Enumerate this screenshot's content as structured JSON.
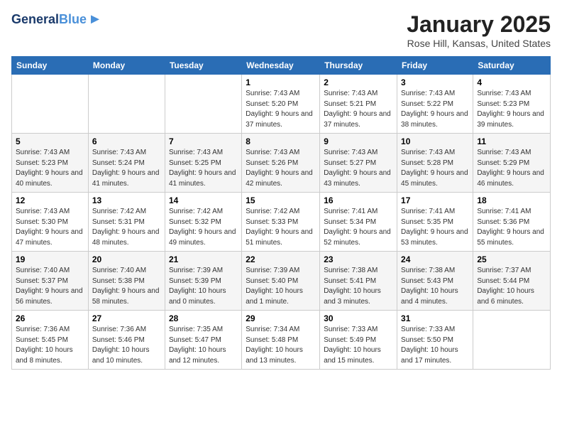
{
  "logo": {
    "line1": "General",
    "line2": "Blue"
  },
  "title": "January 2025",
  "subtitle": "Rose Hill, Kansas, United States",
  "weekdays": [
    "Sunday",
    "Monday",
    "Tuesday",
    "Wednesday",
    "Thursday",
    "Friday",
    "Saturday"
  ],
  "weeks": [
    [
      {
        "num": "",
        "info": ""
      },
      {
        "num": "",
        "info": ""
      },
      {
        "num": "",
        "info": ""
      },
      {
        "num": "1",
        "info": "Sunrise: 7:43 AM\nSunset: 5:20 PM\nDaylight: 9 hours and 37 minutes."
      },
      {
        "num": "2",
        "info": "Sunrise: 7:43 AM\nSunset: 5:21 PM\nDaylight: 9 hours and 37 minutes."
      },
      {
        "num": "3",
        "info": "Sunrise: 7:43 AM\nSunset: 5:22 PM\nDaylight: 9 hours and 38 minutes."
      },
      {
        "num": "4",
        "info": "Sunrise: 7:43 AM\nSunset: 5:23 PM\nDaylight: 9 hours and 39 minutes."
      }
    ],
    [
      {
        "num": "5",
        "info": "Sunrise: 7:43 AM\nSunset: 5:23 PM\nDaylight: 9 hours and 40 minutes."
      },
      {
        "num": "6",
        "info": "Sunrise: 7:43 AM\nSunset: 5:24 PM\nDaylight: 9 hours and 41 minutes."
      },
      {
        "num": "7",
        "info": "Sunrise: 7:43 AM\nSunset: 5:25 PM\nDaylight: 9 hours and 41 minutes."
      },
      {
        "num": "8",
        "info": "Sunrise: 7:43 AM\nSunset: 5:26 PM\nDaylight: 9 hours and 42 minutes."
      },
      {
        "num": "9",
        "info": "Sunrise: 7:43 AM\nSunset: 5:27 PM\nDaylight: 9 hours and 43 minutes."
      },
      {
        "num": "10",
        "info": "Sunrise: 7:43 AM\nSunset: 5:28 PM\nDaylight: 9 hours and 45 minutes."
      },
      {
        "num": "11",
        "info": "Sunrise: 7:43 AM\nSunset: 5:29 PM\nDaylight: 9 hours and 46 minutes."
      }
    ],
    [
      {
        "num": "12",
        "info": "Sunrise: 7:43 AM\nSunset: 5:30 PM\nDaylight: 9 hours and 47 minutes."
      },
      {
        "num": "13",
        "info": "Sunrise: 7:42 AM\nSunset: 5:31 PM\nDaylight: 9 hours and 48 minutes."
      },
      {
        "num": "14",
        "info": "Sunrise: 7:42 AM\nSunset: 5:32 PM\nDaylight: 9 hours and 49 minutes."
      },
      {
        "num": "15",
        "info": "Sunrise: 7:42 AM\nSunset: 5:33 PM\nDaylight: 9 hours and 51 minutes."
      },
      {
        "num": "16",
        "info": "Sunrise: 7:41 AM\nSunset: 5:34 PM\nDaylight: 9 hours and 52 minutes."
      },
      {
        "num": "17",
        "info": "Sunrise: 7:41 AM\nSunset: 5:35 PM\nDaylight: 9 hours and 53 minutes."
      },
      {
        "num": "18",
        "info": "Sunrise: 7:41 AM\nSunset: 5:36 PM\nDaylight: 9 hours and 55 minutes."
      }
    ],
    [
      {
        "num": "19",
        "info": "Sunrise: 7:40 AM\nSunset: 5:37 PM\nDaylight: 9 hours and 56 minutes."
      },
      {
        "num": "20",
        "info": "Sunrise: 7:40 AM\nSunset: 5:38 PM\nDaylight: 9 hours and 58 minutes."
      },
      {
        "num": "21",
        "info": "Sunrise: 7:39 AM\nSunset: 5:39 PM\nDaylight: 10 hours and 0 minutes."
      },
      {
        "num": "22",
        "info": "Sunrise: 7:39 AM\nSunset: 5:40 PM\nDaylight: 10 hours and 1 minute."
      },
      {
        "num": "23",
        "info": "Sunrise: 7:38 AM\nSunset: 5:41 PM\nDaylight: 10 hours and 3 minutes."
      },
      {
        "num": "24",
        "info": "Sunrise: 7:38 AM\nSunset: 5:43 PM\nDaylight: 10 hours and 4 minutes."
      },
      {
        "num": "25",
        "info": "Sunrise: 7:37 AM\nSunset: 5:44 PM\nDaylight: 10 hours and 6 minutes."
      }
    ],
    [
      {
        "num": "26",
        "info": "Sunrise: 7:36 AM\nSunset: 5:45 PM\nDaylight: 10 hours and 8 minutes."
      },
      {
        "num": "27",
        "info": "Sunrise: 7:36 AM\nSunset: 5:46 PM\nDaylight: 10 hours and 10 minutes."
      },
      {
        "num": "28",
        "info": "Sunrise: 7:35 AM\nSunset: 5:47 PM\nDaylight: 10 hours and 12 minutes."
      },
      {
        "num": "29",
        "info": "Sunrise: 7:34 AM\nSunset: 5:48 PM\nDaylight: 10 hours and 13 minutes."
      },
      {
        "num": "30",
        "info": "Sunrise: 7:33 AM\nSunset: 5:49 PM\nDaylight: 10 hours and 15 minutes."
      },
      {
        "num": "31",
        "info": "Sunrise: 7:33 AM\nSunset: 5:50 PM\nDaylight: 10 hours and 17 minutes."
      },
      {
        "num": "",
        "info": ""
      }
    ]
  ]
}
